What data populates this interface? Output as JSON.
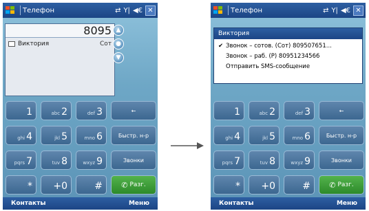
{
  "left_phone": {
    "title": "Телефон",
    "status_icons": {
      "connectivity": "⇄",
      "signal": "Y|",
      "volume": "◀€"
    },
    "close_label": "✕",
    "dialed_number": "8095",
    "suggestion": {
      "name": "Виктория",
      "col2": "Сот"
    },
    "keys": [
      {
        "sub": "",
        "main": "1"
      },
      {
        "sub": "abc",
        "main": "2"
      },
      {
        "sub": "def",
        "main": "3"
      },
      {
        "label": "←"
      },
      {
        "sub": "ghi",
        "main": "4"
      },
      {
        "sub": "jkl",
        "main": "5"
      },
      {
        "sub": "mno",
        "main": "6"
      },
      {
        "label": "Быстр. н-р"
      },
      {
        "sub": "pqrs",
        "main": "7"
      },
      {
        "sub": "tuv",
        "main": "8"
      },
      {
        "sub": "wxyz",
        "main": "9"
      },
      {
        "label": "Звонки"
      },
      {
        "sub": "",
        "main": "*"
      },
      {
        "sub": "",
        "main": "+0"
      },
      {
        "sub": "",
        "main": "#"
      },
      {
        "label": "Разг."
      }
    ],
    "softkeys": {
      "left": "Контакты",
      "right": "Меню"
    }
  },
  "right_phone": {
    "title": "Телефон",
    "close_label": "✕",
    "popup": {
      "title": "Виктория",
      "items": [
        {
          "check": "✔",
          "text": "Звонок – сотов. (Сот) 809507651..."
        },
        {
          "check": "",
          "text": "Звонок – раб. (Р) 80951234566"
        },
        {
          "check": "",
          "text": "Отправить SMS-сообщение"
        }
      ]
    },
    "softkeys": {
      "left": "Контакты",
      "right": "Меню"
    }
  },
  "colors": {
    "titlebar": "#1c4585",
    "background": "#6ea7c6",
    "call_key": "#2d8a2a"
  }
}
